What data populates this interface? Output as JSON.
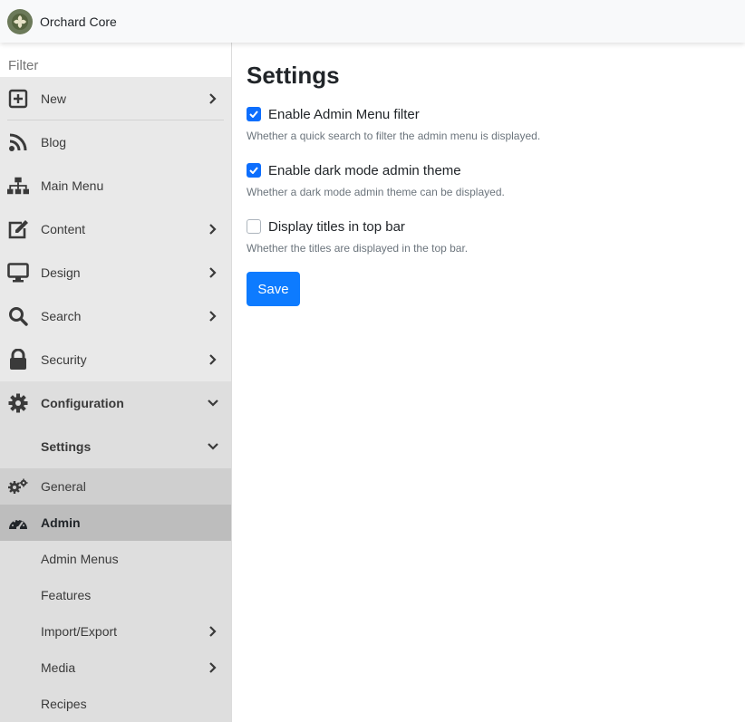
{
  "app": {
    "brand": "Orchard Core"
  },
  "sidebar": {
    "filter_placeholder": "Filter",
    "items": [
      {
        "label": "New",
        "icon": "plus-square-icon"
      },
      {
        "label": "Blog",
        "icon": "rss-icon"
      },
      {
        "label": "Main Menu",
        "icon": "sitemap-icon"
      },
      {
        "label": "Content",
        "icon": "edit-icon"
      },
      {
        "label": "Design",
        "icon": "desktop-icon"
      },
      {
        "label": "Search",
        "icon": "search-icon"
      },
      {
        "label": "Security",
        "icon": "lock-icon"
      },
      {
        "label": "Configuration",
        "icon": "gear-icon"
      }
    ],
    "configuration": {
      "settings_label": "Settings",
      "children": [
        {
          "label": "General",
          "icon": "gears-icon"
        },
        {
          "label": "Admin",
          "icon": "gauge-icon"
        },
        {
          "label": "Admin Menus"
        },
        {
          "label": "Features"
        },
        {
          "label": "Import/Export"
        },
        {
          "label": "Media"
        },
        {
          "label": "Recipes"
        }
      ]
    }
  },
  "main": {
    "title": "Settings",
    "options": [
      {
        "label": "Enable Admin Menu filter",
        "hint": "Whether a quick search to filter the admin menu is displayed.",
        "checked": true
      },
      {
        "label": "Enable dark mode admin theme",
        "hint": "Whether a dark mode admin theme can be displayed.",
        "checked": true
      },
      {
        "label": "Display titles in top bar",
        "hint": "Whether the titles are displayed in the top bar.",
        "checked": false
      }
    ],
    "save_label": "Save"
  },
  "colors": {
    "accent": "#0d7bff",
    "sidebar_bg": "#e9e9e9",
    "active_bg": "#bdbdbd"
  }
}
